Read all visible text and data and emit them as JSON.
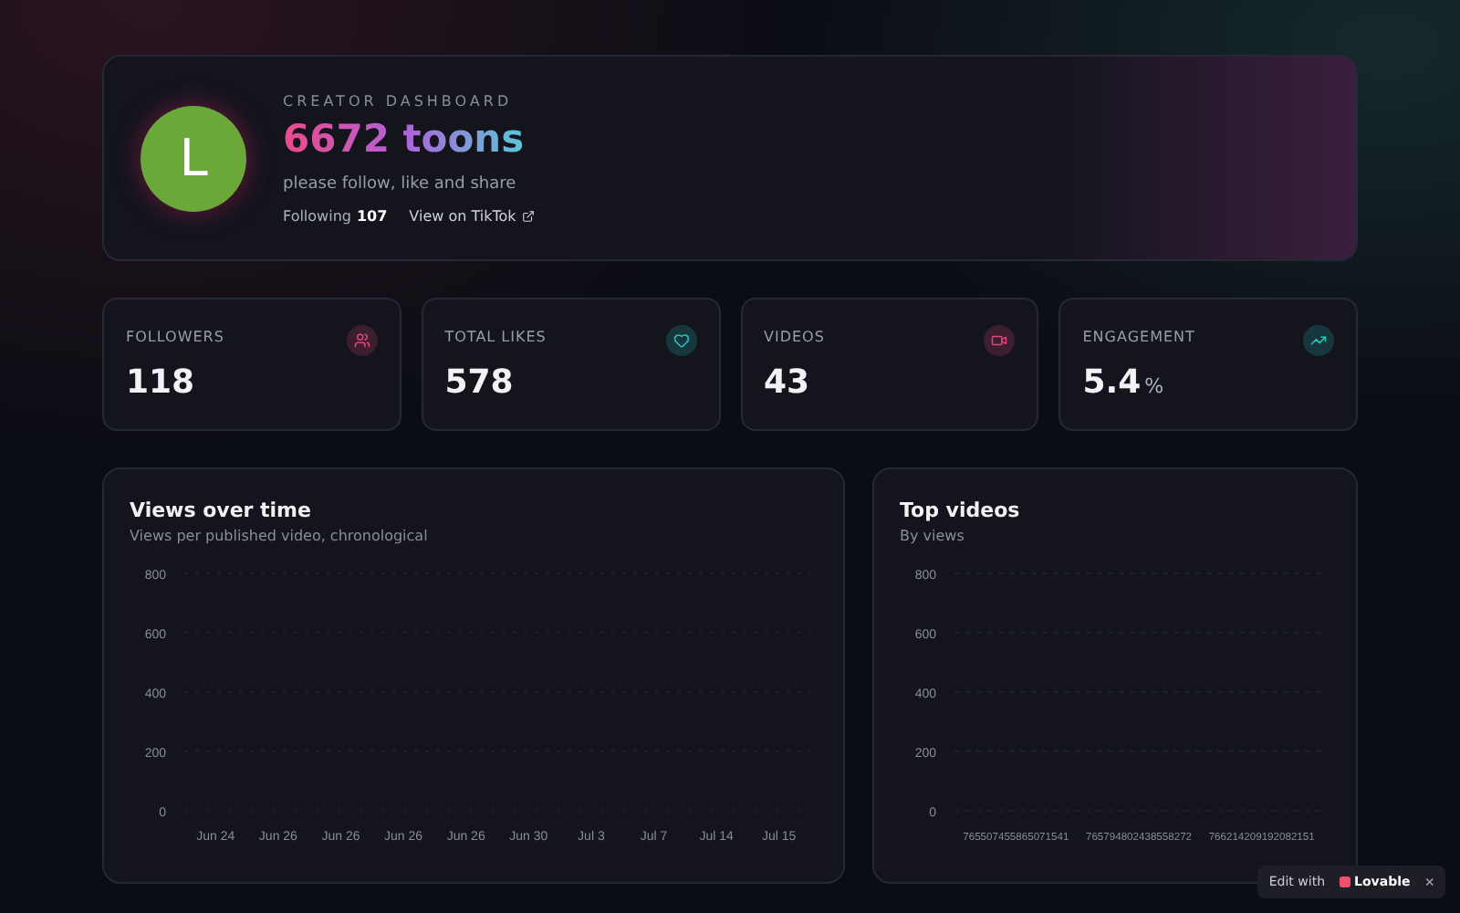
{
  "profile": {
    "avatar_letter": "L",
    "eyebrow": "CREATOR DASHBOARD",
    "name": "6672 toons",
    "bio": "please follow, like and share",
    "following_label": "Following",
    "following_count": "107",
    "link": "View on TikTok"
  },
  "stats": [
    {
      "label": "FOLLOWERS",
      "value": "118",
      "kind": "users",
      "color": "#e0457b"
    },
    {
      "label": "TOTAL LIKES",
      "value": "578",
      "kind": "heart",
      "color": "#2cc4c4"
    },
    {
      "label": "VIDEOS",
      "value": "43",
      "kind": "video",
      "color": "#e0457b"
    },
    {
      "label": "ENGAGEMENT",
      "value": "5.4",
      "unit": "%",
      "kind": "trend",
      "color": "#2cc4c4"
    }
  ],
  "charts": [
    {
      "title": "Views over time",
      "subtitle": "Views per published video, chronological",
      "chart_data": {
        "type": "line",
        "categories": [
          "Jun 24",
          "Jun 26",
          "Jun 26",
          "Jun 26",
          "Jun 26",
          "Jun 30",
          "Jul 3",
          "Jul 7",
          "Jul 14",
          "Jul 15"
        ],
        "ylim": [
          0,
          800
        ],
        "yticks": [
          0,
          200,
          400,
          600,
          800
        ],
        "grid": true
      }
    },
    {
      "title": "Top videos",
      "subtitle": "By views",
      "chart_data": {
        "type": "bar",
        "categories": [
          "765507455865071541",
          "765794802438558272",
          "766214209192082151"
        ],
        "ylim": [
          0,
          800
        ],
        "yticks": [
          0,
          200,
          400,
          600,
          800
        ],
        "grid": true
      }
    }
  ],
  "badge": {
    "prefix": "Edit with",
    "brand": "Lovable",
    "close": "×"
  }
}
